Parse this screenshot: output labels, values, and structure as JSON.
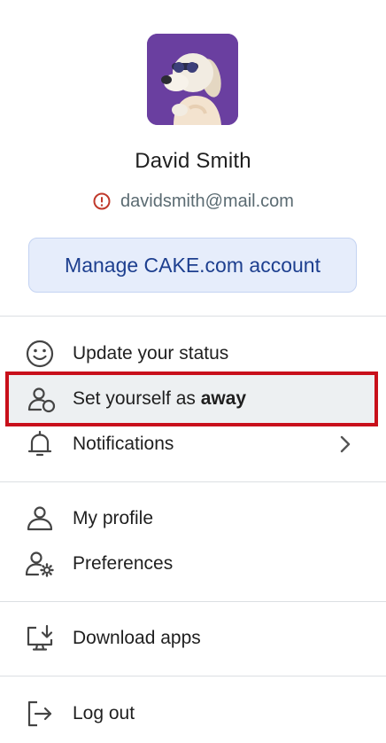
{
  "profile": {
    "name": "David Smith",
    "email": "davidsmith@mail.com",
    "email_status_icon": "warning-circle-icon",
    "avatar_icon": "dog-avatar"
  },
  "manage_account": {
    "label": "Manage CAKE.com account"
  },
  "menu": {
    "update_status": {
      "label": "Update your status",
      "icon": "smiley-icon"
    },
    "set_away": {
      "label_prefix": "Set yourself as ",
      "label_bold": "away",
      "icon": "person-away-icon"
    },
    "notifications": {
      "label": "Notifications",
      "icon": "bell-icon",
      "chevron": "chevron-right-icon"
    },
    "my_profile": {
      "label": "My profile",
      "icon": "person-icon"
    },
    "preferences": {
      "label": "Preferences",
      "icon": "person-gear-icon"
    },
    "download_apps": {
      "label": "Download apps",
      "icon": "monitor-download-icon"
    },
    "log_out": {
      "label": "Log out",
      "icon": "logout-icon"
    }
  },
  "colors": {
    "accent": "#1d3f8f",
    "manage_bg": "#e6edfb",
    "highlight_border": "#c8101b",
    "warning": "#c0392b"
  }
}
